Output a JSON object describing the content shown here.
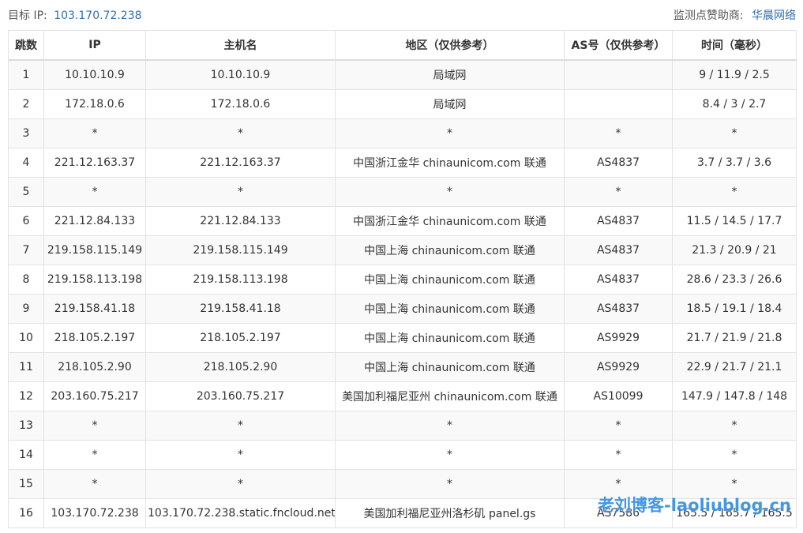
{
  "header": {
    "target_label": "目标 IP:",
    "target_ip": "103.170.72.238",
    "sponsor_label": "监测点赞助商:",
    "sponsor_name": "华晨网络"
  },
  "columns": [
    "跳数",
    "IP",
    "主机名",
    "地区（仅供参考）",
    "AS号（仅供参考）",
    "时间（毫秒）"
  ],
  "rows": [
    {
      "hop": "1",
      "ip": "10.10.10.9",
      "host": "10.10.10.9",
      "region": "局域网",
      "asn": "",
      "time": "9 / 11.9 / 2.5"
    },
    {
      "hop": "2",
      "ip": "172.18.0.6",
      "host": "172.18.0.6",
      "region": "局域网",
      "asn": "",
      "time": "8.4 / 3 / 2.7"
    },
    {
      "hop": "3",
      "ip": "*",
      "host": "*",
      "region": "*",
      "asn": "*",
      "time": "*"
    },
    {
      "hop": "4",
      "ip": "221.12.163.37",
      "host": "221.12.163.37",
      "region": "中国浙江金华 chinaunicom.com 联通",
      "asn": "AS4837",
      "time": "3.7 / 3.7 / 3.6"
    },
    {
      "hop": "5",
      "ip": "*",
      "host": "*",
      "region": "*",
      "asn": "*",
      "time": "*"
    },
    {
      "hop": "6",
      "ip": "221.12.84.133",
      "host": "221.12.84.133",
      "region": "中国浙江金华 chinaunicom.com 联通",
      "asn": "AS4837",
      "time": "11.5 / 14.5 / 17.7"
    },
    {
      "hop": "7",
      "ip": "219.158.115.149",
      "host": "219.158.115.149",
      "region": "中国上海 chinaunicom.com 联通",
      "asn": "AS4837",
      "time": "21.3 / 20.9 / 21"
    },
    {
      "hop": "8",
      "ip": "219.158.113.198",
      "host": "219.158.113.198",
      "region": "中国上海 chinaunicom.com 联通",
      "asn": "AS4837",
      "time": "28.6 / 23.3 / 26.6"
    },
    {
      "hop": "9",
      "ip": "219.158.41.18",
      "host": "219.158.41.18",
      "region": "中国上海 chinaunicom.com 联通",
      "asn": "AS4837",
      "time": "18.5 / 19.1 / 18.4"
    },
    {
      "hop": "10",
      "ip": "218.105.2.197",
      "host": "218.105.2.197",
      "region": "中国上海 chinaunicom.com 联通",
      "asn": "AS9929",
      "time": "21.7 / 21.9 / 21.8"
    },
    {
      "hop": "11",
      "ip": "218.105.2.90",
      "host": "218.105.2.90",
      "region": "中国上海 chinaunicom.com 联通",
      "asn": "AS9929",
      "time": "22.9 / 21.7 / 21.1"
    },
    {
      "hop": "12",
      "ip": "203.160.75.217",
      "host": "203.160.75.217",
      "region": "美国加利福尼亚州 chinaunicom.com 联通",
      "asn": "AS10099",
      "time": "147.9 / 147.8 / 148"
    },
    {
      "hop": "13",
      "ip": "*",
      "host": "*",
      "region": "*",
      "asn": "*",
      "time": "*"
    },
    {
      "hop": "14",
      "ip": "*",
      "host": "*",
      "region": "*",
      "asn": "*",
      "time": "*"
    },
    {
      "hop": "15",
      "ip": "*",
      "host": "*",
      "region": "*",
      "asn": "*",
      "time": "*"
    },
    {
      "hop": "16",
      "ip": "103.170.72.238",
      "host": "103.170.72.238.static.fncloud.net",
      "region": "美国加利福尼亚州洛杉矶 panel.gs",
      "asn": "AS7586",
      "time": "165.5 / 165.7 / 165.5"
    }
  ],
  "watermark": "老刘博客-laoliublog.cn",
  "colors": {
    "link": "#2f6fad",
    "watermark": "#2f8ce0"
  }
}
